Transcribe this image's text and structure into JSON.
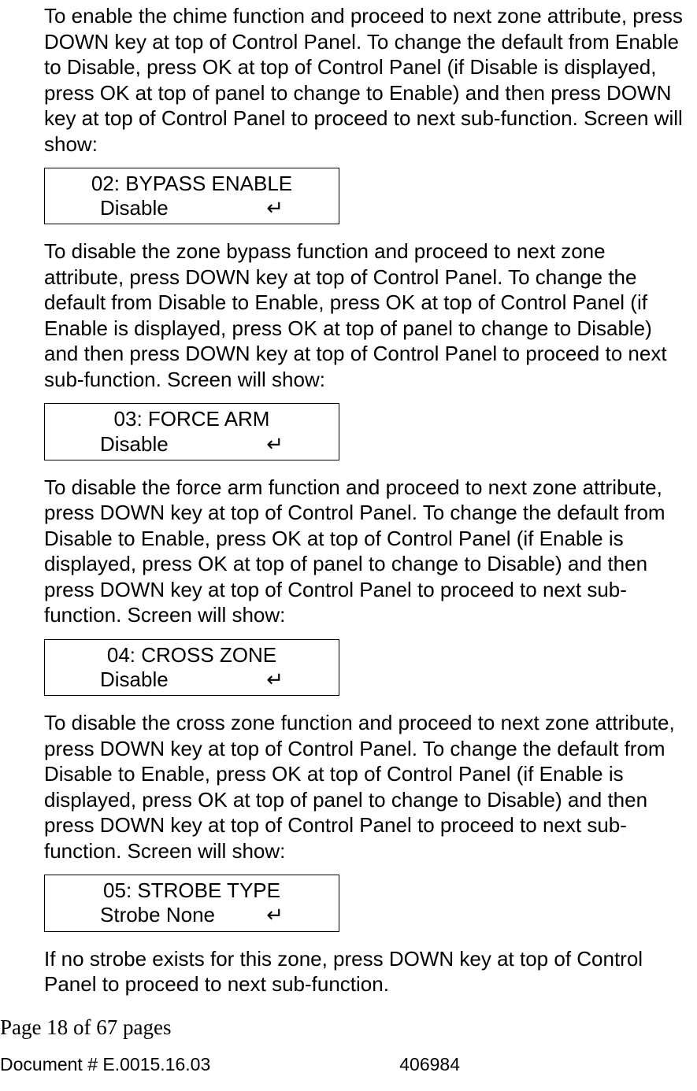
{
  "paragraphs": {
    "p1": "To enable the chime function and proceed to next zone attribute, press DOWN key at top of Control Panel. To change the default from Enable to Disable, press OK at top of Control Panel (if Disable is displayed, press OK at top of panel to change to Enable) and then press DOWN key at top of Control Panel to proceed to next sub-function. Screen will show:",
    "p2": "To disable the zone bypass function and proceed to next zone attribute, press DOWN key at top of Control Panel. To change the default from Disable to Enable, press OK at top of Control Panel (if Enable is displayed, press OK at top of panel to change to Disable) and then press DOWN key at top of Control Panel to proceed to next sub-function. Screen will show:",
    "p3": "To disable the force arm function and proceed to next zone attribute, press DOWN key at top of Control Panel. To change the default from Disable to Enable, press OK at top of Control Panel (if Enable is displayed, press OK at top of panel to change to Disable) and then press DOWN key at top of Control Panel to proceed to next sub-function. Screen will show:",
    "p4": "To disable the cross zone function and proceed to next zone attribute, press DOWN key at top of Control Panel. To change the default from Disable to Enable, press OK at top of Control Panel (if Enable is displayed, press OK at top of panel to change to Disable) and then press DOWN key at top of Control Panel to proceed to next sub-function. Screen will show:",
    "p5": "If no strobe exists for this zone, press DOWN key at top of Control Panel to proceed to next sub-function."
  },
  "screens": {
    "s1": {
      "line1": "02: BYPASS ENABLE",
      "value": "Disable",
      "ret": "↵"
    },
    "s2": {
      "line1": "03: FORCE ARM",
      "value": "Disable",
      "ret": "↵"
    },
    "s3": {
      "line1": "04: CROSS ZONE",
      "value": "Disable",
      "ret": "↵"
    },
    "s4": {
      "line1": "05: STROBE TYPE",
      "value": "Strobe None",
      "ret": "↵"
    }
  },
  "footer": {
    "page": "Page 18 of  67 pages",
    "doc": "Document # E.0015.16.03",
    "id": "406984"
  }
}
